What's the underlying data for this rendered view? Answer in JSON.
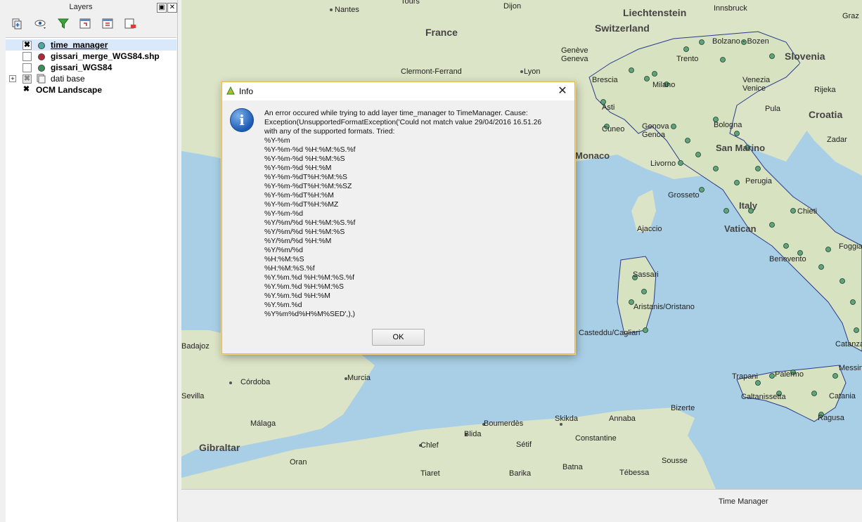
{
  "layers_panel": {
    "title": "Layers",
    "float_button": "▣",
    "close_button": "✕",
    "toolbar_icons": [
      "add-group-icon",
      "visibility-icon",
      "filter-icon",
      "expand-all-icon",
      "collapse-all-icon",
      "remove-layer-icon"
    ],
    "layers": [
      {
        "name": "time_manager",
        "checked": true,
        "selected": true,
        "color": "#4fa8a0"
      },
      {
        "name": "gissari_merge_WGS84.shp",
        "checked": false,
        "color": "#b0283a"
      },
      {
        "name": "gissari_WGS84",
        "checked": false,
        "color": "#3d8f5a"
      },
      {
        "name": "dati base",
        "checked": false,
        "group": true
      },
      {
        "name": "OCM Landscape",
        "checked": true
      }
    ]
  },
  "map": {
    "labels": [
      "Nantes",
      "Tours",
      "Dijon",
      "Liechtenstein",
      "Innsbruck",
      "Graz",
      "France",
      "Switzerland",
      "Genève Geneva",
      "Bolzano - Bozen",
      "Slovenia",
      "Trento",
      "Clermont-Ferrand",
      "Lyon",
      "Brescia",
      "Milano",
      "Venezia Venice",
      "Rijeka",
      "Pula",
      "Croatia",
      "Asti",
      "Bologna",
      "Cuneo",
      "Genova Genoa",
      "San Marino",
      "Zadar",
      "Monaco",
      "Livorno",
      "Perugia",
      "Grosseto",
      "Italy",
      "Chieti",
      "Vatican",
      "Ajaccio",
      "Foggia",
      "Sassari",
      "Benevento",
      "Aristanis/Oristano",
      "Cagliari",
      "Casteddu/Cagliari",
      "Catanzaro",
      "Badajoz",
      "Córdoba",
      "Murcia",
      "Trapani",
      "Palermo",
      "Messina",
      "Sevilla",
      "Bizerte",
      "Caltanissetta",
      "Catania",
      "Málaga",
      "Boumerdès",
      "Skikda",
      "Annaba",
      "Ragusa",
      "Gibraltar",
      "Blida",
      "Chlef",
      "Sétif",
      "Constantine",
      "Oran",
      "Tiaret",
      "Barika",
      "Batna",
      "Tébessa",
      "Sousse",
      "Ajaccio",
      "Annaba"
    ],
    "sea_color": "#a9cfe6",
    "land_color": "#d9e3c4",
    "point_color": "#5fa37a"
  },
  "dock": {
    "label": "Time Manager"
  },
  "dialog": {
    "title": "Info",
    "close": "✕",
    "message": "An error occured while trying to add layer time_manager to TimeManager. Cause:\nException(UnsupportedFormatException('Could not match value 29/04/2016 16.51.26\nwith any of the supported formats. Tried:\n%Y-%m\n%Y-%m-%d %H:%M:%S.%f\n%Y-%m-%d %H:%M:%S\n%Y-%m-%d %H:%M\n%Y-%m-%dT%H:%M:%S\n%Y-%m-%dT%H:%M:%SZ\n%Y-%m-%dT%H:%M\n%Y-%m-%dT%H:%MZ\n%Y-%m-%d\n%Y/%m/%d %H:%M:%S.%f\n%Y/%m/%d %H:%M:%S\n%Y/%m/%d %H:%M\n%Y/%m/%d\n%H:%M:%S\n%H:%M:%S.%f\n%Y.%m.%d %H:%M:%S.%f\n%Y.%m.%d %H:%M:%S\n%Y.%m.%d %H:%M\n%Y.%m.%d\n%Y%m%d%H%M%SED',),)",
    "ok_label": "OK"
  }
}
